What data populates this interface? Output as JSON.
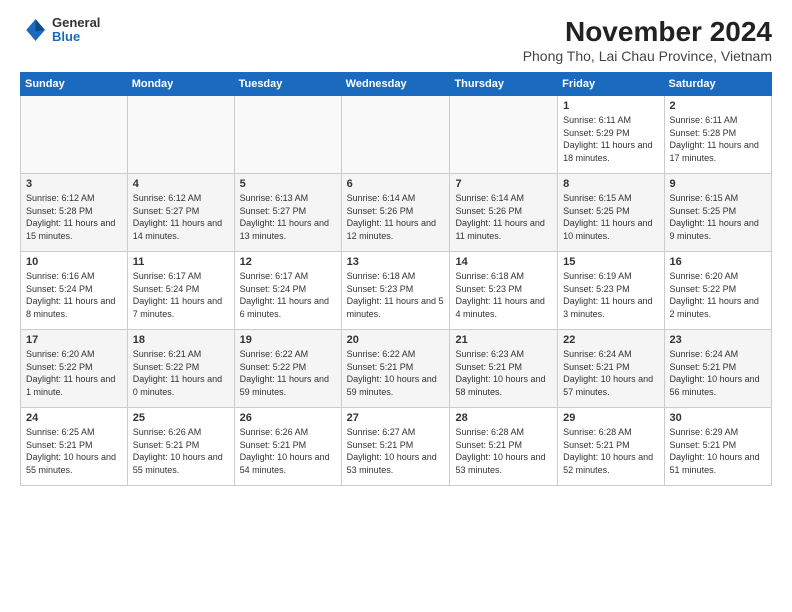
{
  "logo": {
    "general": "General",
    "blue": "Blue"
  },
  "header": {
    "title": "November 2024",
    "subtitle": "Phong Tho, Lai Chau Province, Vietnam"
  },
  "weekdays": [
    "Sunday",
    "Monday",
    "Tuesday",
    "Wednesday",
    "Thursday",
    "Friday",
    "Saturday"
  ],
  "weeks": [
    [
      {
        "day": "",
        "info": ""
      },
      {
        "day": "",
        "info": ""
      },
      {
        "day": "",
        "info": ""
      },
      {
        "day": "",
        "info": ""
      },
      {
        "day": "",
        "info": ""
      },
      {
        "day": "1",
        "info": "Sunrise: 6:11 AM\nSunset: 5:29 PM\nDaylight: 11 hours and 18 minutes."
      },
      {
        "day": "2",
        "info": "Sunrise: 6:11 AM\nSunset: 5:28 PM\nDaylight: 11 hours and 17 minutes."
      }
    ],
    [
      {
        "day": "3",
        "info": "Sunrise: 6:12 AM\nSunset: 5:28 PM\nDaylight: 11 hours and 15 minutes."
      },
      {
        "day": "4",
        "info": "Sunrise: 6:12 AM\nSunset: 5:27 PM\nDaylight: 11 hours and 14 minutes."
      },
      {
        "day": "5",
        "info": "Sunrise: 6:13 AM\nSunset: 5:27 PM\nDaylight: 11 hours and 13 minutes."
      },
      {
        "day": "6",
        "info": "Sunrise: 6:14 AM\nSunset: 5:26 PM\nDaylight: 11 hours and 12 minutes."
      },
      {
        "day": "7",
        "info": "Sunrise: 6:14 AM\nSunset: 5:26 PM\nDaylight: 11 hours and 11 minutes."
      },
      {
        "day": "8",
        "info": "Sunrise: 6:15 AM\nSunset: 5:25 PM\nDaylight: 11 hours and 10 minutes."
      },
      {
        "day": "9",
        "info": "Sunrise: 6:15 AM\nSunset: 5:25 PM\nDaylight: 11 hours and 9 minutes."
      }
    ],
    [
      {
        "day": "10",
        "info": "Sunrise: 6:16 AM\nSunset: 5:24 PM\nDaylight: 11 hours and 8 minutes."
      },
      {
        "day": "11",
        "info": "Sunrise: 6:17 AM\nSunset: 5:24 PM\nDaylight: 11 hours and 7 minutes."
      },
      {
        "day": "12",
        "info": "Sunrise: 6:17 AM\nSunset: 5:24 PM\nDaylight: 11 hours and 6 minutes."
      },
      {
        "day": "13",
        "info": "Sunrise: 6:18 AM\nSunset: 5:23 PM\nDaylight: 11 hours and 5 minutes."
      },
      {
        "day": "14",
        "info": "Sunrise: 6:18 AM\nSunset: 5:23 PM\nDaylight: 11 hours and 4 minutes."
      },
      {
        "day": "15",
        "info": "Sunrise: 6:19 AM\nSunset: 5:23 PM\nDaylight: 11 hours and 3 minutes."
      },
      {
        "day": "16",
        "info": "Sunrise: 6:20 AM\nSunset: 5:22 PM\nDaylight: 11 hours and 2 minutes."
      }
    ],
    [
      {
        "day": "17",
        "info": "Sunrise: 6:20 AM\nSunset: 5:22 PM\nDaylight: 11 hours and 1 minute."
      },
      {
        "day": "18",
        "info": "Sunrise: 6:21 AM\nSunset: 5:22 PM\nDaylight: 11 hours and 0 minutes."
      },
      {
        "day": "19",
        "info": "Sunrise: 6:22 AM\nSunset: 5:22 PM\nDaylight: 11 hours and\n59 minutes."
      },
      {
        "day": "20",
        "info": "Sunrise: 6:22 AM\nSunset: 5:21 PM\nDaylight: 10 hours and 59 minutes."
      },
      {
        "day": "21",
        "info": "Sunrise: 6:23 AM\nSunset: 5:21 PM\nDaylight: 10 hours and 58 minutes."
      },
      {
        "day": "22",
        "info": "Sunrise: 6:24 AM\nSunset: 5:21 PM\nDaylight: 10 hours and 57 minutes."
      },
      {
        "day": "23",
        "info": "Sunrise: 6:24 AM\nSunset: 5:21 PM\nDaylight: 10 hours and 56 minutes."
      }
    ],
    [
      {
        "day": "24",
        "info": "Sunrise: 6:25 AM\nSunset: 5:21 PM\nDaylight: 10 hours and 55 minutes."
      },
      {
        "day": "25",
        "info": "Sunrise: 6:26 AM\nSunset: 5:21 PM\nDaylight: 10 hours and 55 minutes."
      },
      {
        "day": "26",
        "info": "Sunrise: 6:26 AM\nSunset: 5:21 PM\nDaylight: 10 hours and 54 minutes."
      },
      {
        "day": "27",
        "info": "Sunrise: 6:27 AM\nSunset: 5:21 PM\nDaylight: 10 hours and 53 minutes."
      },
      {
        "day": "28",
        "info": "Sunrise: 6:28 AM\nSunset: 5:21 PM\nDaylight: 10 hours and 53 minutes."
      },
      {
        "day": "29",
        "info": "Sunrise: 6:28 AM\nSunset: 5:21 PM\nDaylight: 10 hours and 52 minutes."
      },
      {
        "day": "30",
        "info": "Sunrise: 6:29 AM\nSunset: 5:21 PM\nDaylight: 10 hours and 51 minutes."
      }
    ]
  ]
}
